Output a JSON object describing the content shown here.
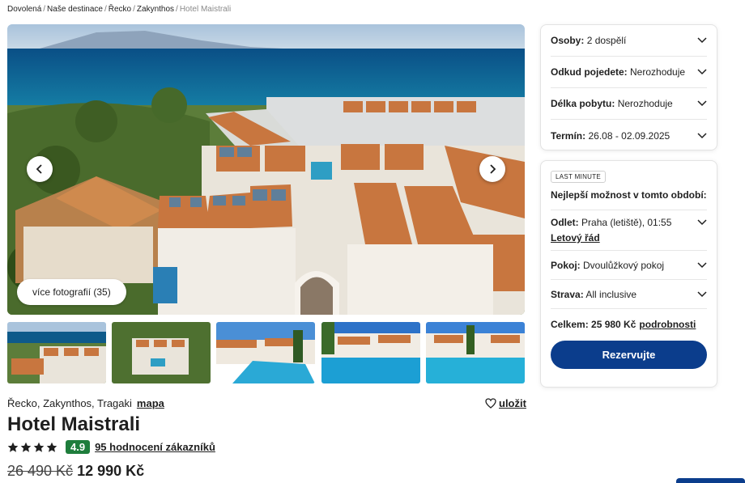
{
  "breadcrumb": {
    "items": [
      "Dovolená",
      "Naše destinace",
      "Řecko",
      "Zakynthos"
    ],
    "current": "Hotel Maistrali",
    "separator": "/"
  },
  "gallery": {
    "more_photos_label": "více fotografií (35)",
    "prev_icon": "chevron-left-icon",
    "next_icon": "chevron-right-icon"
  },
  "hotel": {
    "location": "Řecko, Zakynthos, Tragaki",
    "map_label": "mapa",
    "save_label": "uložit",
    "name": "Hotel Maistrali",
    "stars": 4,
    "score": "4.9",
    "reviews_label": "95 hodnocení zákazníků",
    "old_price": "26 490 Kč",
    "new_price": "12 990 Kč"
  },
  "search": {
    "fields": [
      {
        "label": "Osoby:",
        "value": "2 dospělí"
      },
      {
        "label": "Odkud pojedete:",
        "value": "Nerozhoduje"
      },
      {
        "label": "Délka pobytu:",
        "value": "Nerozhoduje"
      },
      {
        "label": "Termín:",
        "value": "26.08 - 02.09.2025"
      }
    ]
  },
  "offer": {
    "badge": "LAST MINUTE",
    "heading": "Nejlepší možnost v tomto období:",
    "flight_label": "Odlet:",
    "flight_value": "Praha (letiště), 01:55",
    "schedule_link": "Letový řád",
    "room_label": "Pokoj:",
    "room_value": "Dvoulůžkový pokoj",
    "board_label": "Strava:",
    "board_value": "All inclusive",
    "total_label": "Celkem: 25 980 Kč",
    "details_link": "podrobnosti",
    "book_label": "Rezervujte"
  },
  "colors": {
    "primary": "#0b3d8c",
    "score_bg": "#1e7d3c",
    "sea": "#0e5a8a",
    "roof": "#c8763f"
  }
}
